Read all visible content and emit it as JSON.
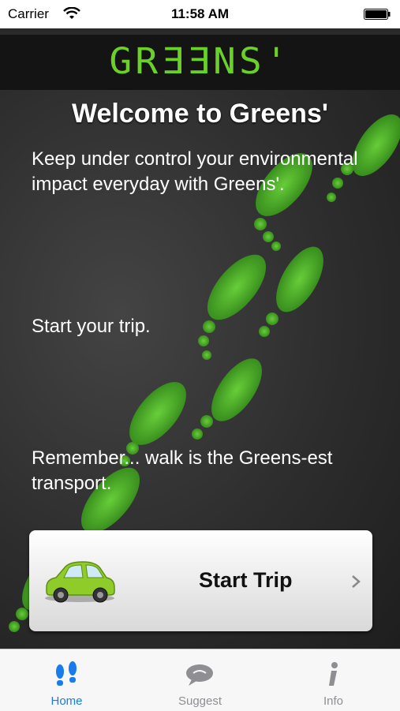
{
  "status_bar": {
    "carrier": "Carrier",
    "time": "11:58 AM"
  },
  "header": {
    "logo": "GRƎƎNS'"
  },
  "main": {
    "title": "Welcome to Greens'",
    "intro": "Keep under control your environmental impact everyday with Greens'.",
    "start_hint": "Start your trip.",
    "remember": "Remember... walk is the Greens-est transport."
  },
  "start_trip": {
    "label": "Start Trip",
    "icon": "car-icon"
  },
  "tab_bar": {
    "tabs": [
      {
        "label": "Home",
        "icon": "footprints-icon",
        "active": true
      },
      {
        "label": "Suggest",
        "icon": "speech-bubble-icon",
        "active": false
      },
      {
        "label": "Info",
        "icon": "info-icon",
        "active": false
      }
    ]
  },
  "colors": {
    "accent": "#6ad128",
    "tab_active": "#1a7bea",
    "tab_inactive": "#8e8e93"
  }
}
